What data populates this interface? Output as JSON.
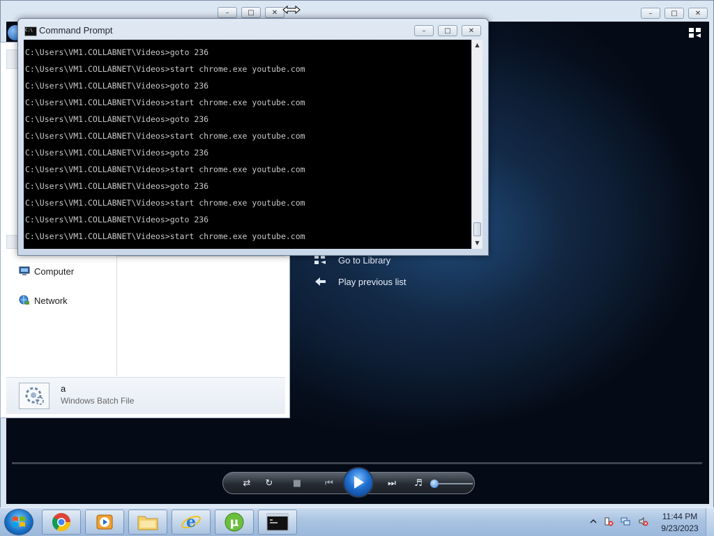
{
  "media_player": {
    "links": [
      {
        "label": "Go to Library",
        "icon": "library-icon"
      },
      {
        "label": "Play previous list",
        "icon": "back-arrow-icon"
      }
    ],
    "controls": {
      "shuffle_icon": "shuffle-icon",
      "repeat_icon": "repeat-icon",
      "stop_icon": "stop-icon",
      "previous_icon": "previous-icon",
      "play_icon": "play-icon",
      "next_icon": "next-icon",
      "mute_icon": "volume-icon",
      "volume_level": 0.05
    }
  },
  "explorer": {
    "nav": [
      {
        "label": "Computer",
        "icon": "computer-icon"
      },
      {
        "label": "Network",
        "icon": "network-icon"
      }
    ],
    "selected_file": {
      "name": "a",
      "type": "Windows Batch File",
      "icon": "batch-file-icon"
    }
  },
  "cmd": {
    "title": "Command Prompt",
    "lines": [
      "C:\\Users\\VM1.COLLABNET\\Videos>goto 236",
      "C:\\Users\\VM1.COLLABNET\\Videos>start chrome.exe youtube.com",
      "C:\\Users\\VM1.COLLABNET\\Videos>goto 236",
      "C:\\Users\\VM1.COLLABNET\\Videos>start chrome.exe youtube.com",
      "C:\\Users\\VM1.COLLABNET\\Videos>goto 236",
      "C:\\Users\\VM1.COLLABNET\\Videos>start chrome.exe youtube.com",
      "C:\\Users\\VM1.COLLABNET\\Videos>goto 236",
      "C:\\Users\\VM1.COLLABNET\\Videos>start chrome.exe youtube.com",
      "C:\\Users\\VM1.COLLABNET\\Videos>goto 236",
      "C:\\Users\\VM1.COLLABNET\\Videos>start chrome.exe youtube.com",
      "C:\\Users\\VM1.COLLABNET\\Videos>goto 236",
      "C:\\Users\\VM1.COLLABNET\\Videos>start chrome.exe youtube.com"
    ]
  },
  "taskbar": {
    "pinned": [
      {
        "name": "chrome",
        "icon": "chrome-icon"
      },
      {
        "name": "media-player",
        "icon": "media-player-icon"
      },
      {
        "name": "file-explorer",
        "icon": "folder-icon"
      },
      {
        "name": "internet-explorer",
        "icon": "ie-icon"
      },
      {
        "name": "utorrent",
        "icon": "utorrent-icon"
      },
      {
        "name": "command-prompt",
        "icon": "cmd-icon"
      }
    ],
    "clock": {
      "time": "11:44 PM",
      "date": "9/23/2023"
    }
  },
  "colors": {
    "console_bg": "#000000",
    "console_text": "#c9c9c9",
    "wmp_accent": "#1e6ed0",
    "taskbar": "#a9c3e2"
  }
}
